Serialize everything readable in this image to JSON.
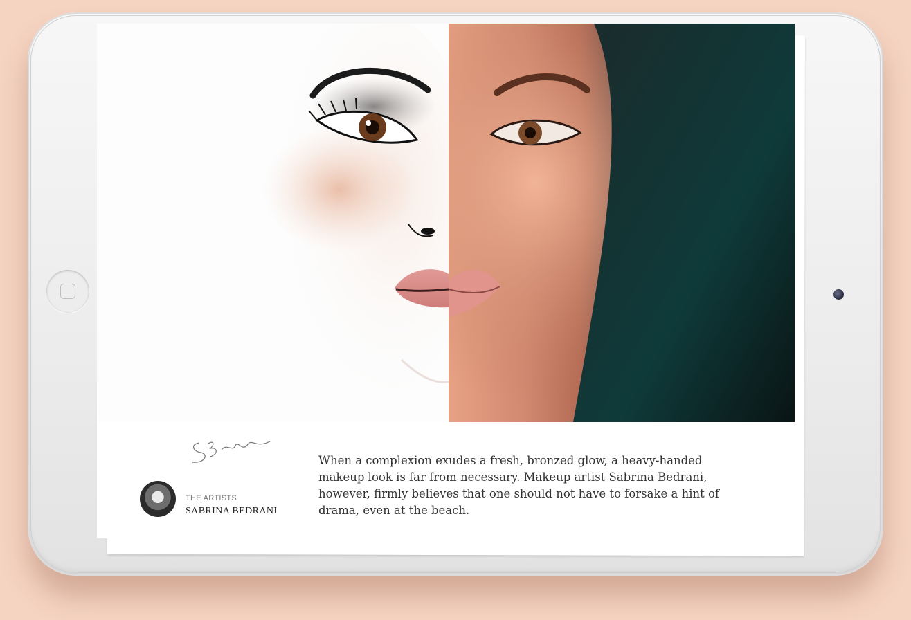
{
  "colors": {
    "background": "#f6d4c2",
    "device_frame": "#efefef",
    "screen": "#ffffff",
    "body_text": "#333333"
  },
  "device": {
    "home_button_icon": "home-button",
    "camera_icon": "front-camera"
  },
  "hero": {
    "left_panel": "makeup face illustration",
    "right_panel": "model face photo"
  },
  "artist": {
    "label": "THE ARTISTS",
    "name": "SABRINA BEDRANI",
    "signature": "SBell"
  },
  "article": {
    "description": "When a complexion exudes a fresh, bronzed glow, a heavy-handed makeup look is far from necessary. Makeup artist Sabrina Bedrani, however, firmly believes that one should not have to forsake a hint of drama, even at the beach."
  }
}
